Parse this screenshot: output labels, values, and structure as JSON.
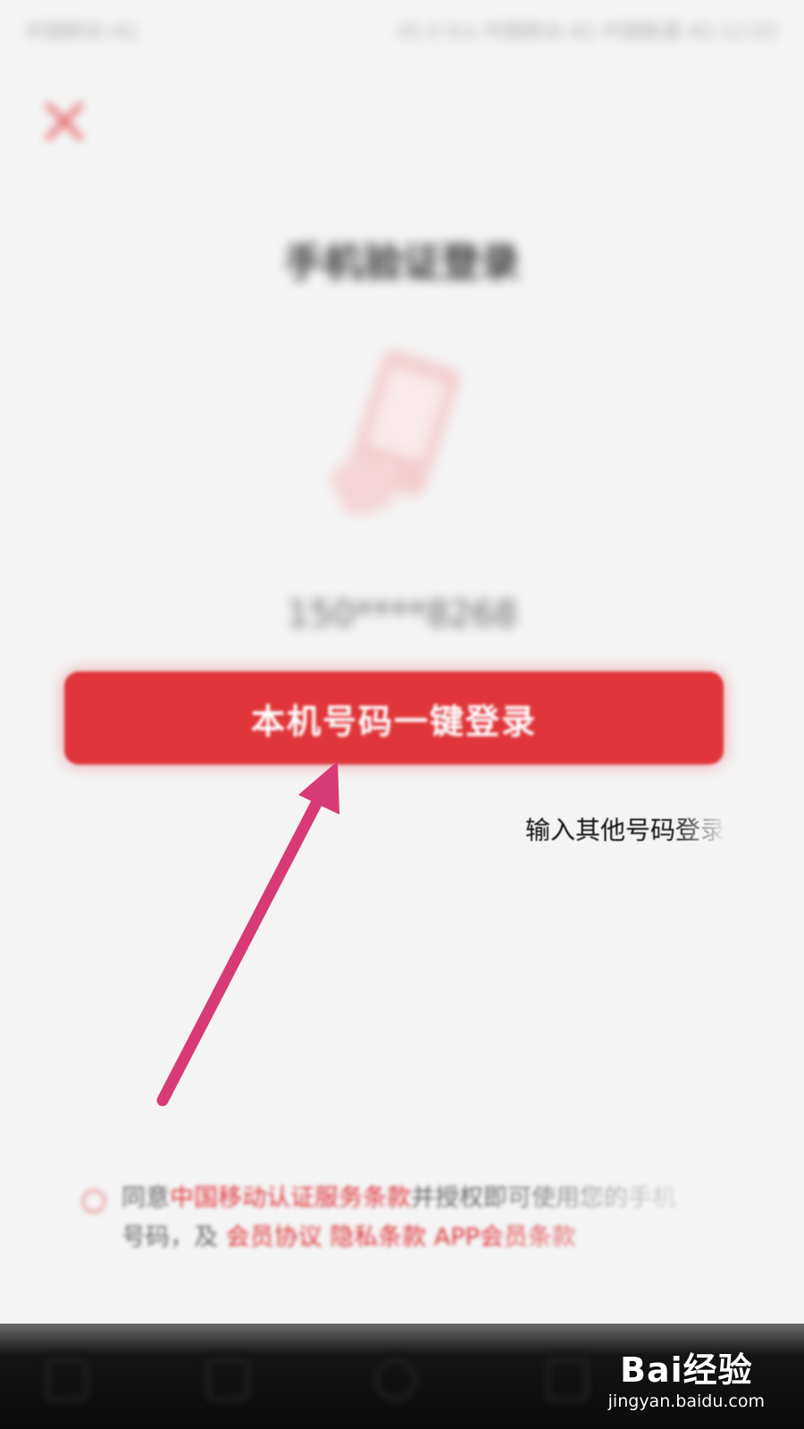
{
  "status_bar": {
    "carrier": "中国移动 4G",
    "right": "45.0 K/s 中国移动 4G 中国联通 4G 12:03"
  },
  "header": {
    "close_icon": "close-icon"
  },
  "page": {
    "title": "手机验证登录",
    "illustration": "phone-icon",
    "masked_number": "150****8268"
  },
  "actions": {
    "one_click_login": "本机号码一键登录",
    "other_number_login": "输入其他号码登录"
  },
  "agreement": {
    "prefix": "同意",
    "cmcc_terms": "中国移动认证服务条款",
    "middle": "并授权即可使用您的手机",
    "line2_prefix": "号码，及",
    "member_agreement": "会员协议",
    "privacy_terms": "隐私条款",
    "app_member": "APP会员条款"
  },
  "watermark": {
    "logo": "Bai经验",
    "url": "jingyan.baidu.com"
  },
  "colors": {
    "accent": "#e0363b",
    "arrow": "#d83a76"
  }
}
